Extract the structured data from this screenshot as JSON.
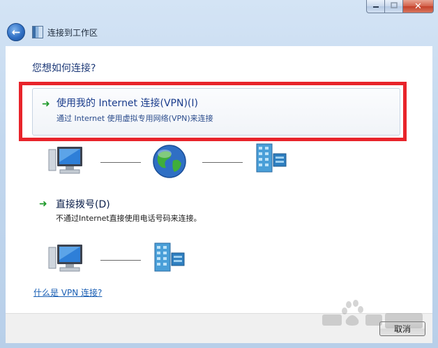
{
  "window": {
    "title": "连接到工作区",
    "controls": {
      "minimize_icon": "minimize-icon",
      "maximize_icon": "maximize-icon",
      "close_icon": "close-icon",
      "close_glyph": "✕"
    }
  },
  "nav": {
    "back_glyph": "←"
  },
  "main": {
    "heading": "您想如何连接?",
    "options": [
      {
        "title": "使用我的 Internet 连接(VPN)(I)",
        "description": "通过 Internet 使用虚拟专用网络(VPN)来连接",
        "arrow_glyph": "➜"
      },
      {
        "title": "直接拨号(D)",
        "description": "不通过Internet直接使用电话号码来连接。",
        "arrow_glyph": "➜"
      }
    ],
    "help_link": "什么是 VPN 连接?"
  },
  "footer": {
    "cancel_label": "取消"
  },
  "colors": {
    "highlight": "#e8242b",
    "link": "#1a5fb4",
    "arrow": "#1f9a2b"
  }
}
